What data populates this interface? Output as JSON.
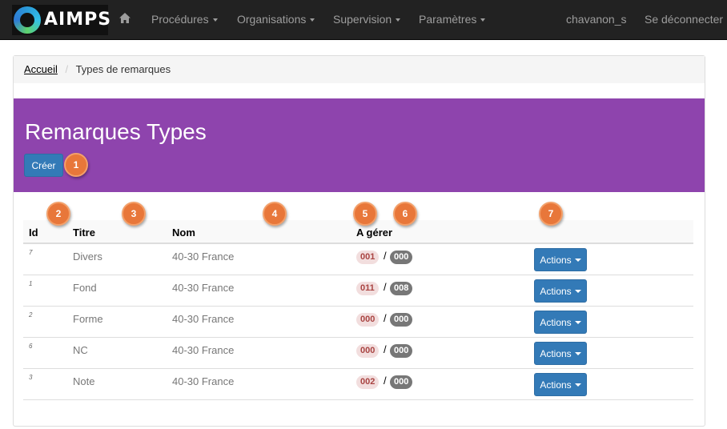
{
  "navbar": {
    "logo_text": "AIMPS",
    "items": [
      {
        "label": "Procédures"
      },
      {
        "label": "Organisations"
      },
      {
        "label": "Supervision"
      },
      {
        "label": "Paramètres"
      }
    ],
    "user": "chavanon_s",
    "logout": "Se déconnecter"
  },
  "breadcrumb": {
    "home": "Accueil",
    "current": "Types de remarques"
  },
  "page": {
    "title": "Remarques Types",
    "create_label": "Créer"
  },
  "table": {
    "headers": [
      "Id",
      "Titre",
      "Nom",
      "A gérer",
      ""
    ],
    "rows": [
      {
        "id": "7",
        "titre": "Divers",
        "nom": "40-30 France",
        "manage": "001",
        "total": "000",
        "action": "Actions"
      },
      {
        "id": "1",
        "titre": "Fond",
        "nom": "40-30 France",
        "manage": "011",
        "total": "008",
        "action": "Actions"
      },
      {
        "id": "2",
        "titre": "Forme",
        "nom": "40-30 France",
        "manage": "000",
        "total": "000",
        "action": "Actions"
      },
      {
        "id": "6",
        "titre": "NC",
        "nom": "40-30 France",
        "manage": "000",
        "total": "000",
        "action": "Actions"
      },
      {
        "id": "3",
        "titre": "Note",
        "nom": "40-30 France",
        "manage": "002",
        "total": "000",
        "action": "Actions"
      }
    ],
    "separator": "/"
  },
  "markers": [
    "1",
    "2",
    "3",
    "4",
    "5",
    "6",
    "7"
  ],
  "colors": {
    "navbar": "#222222",
    "jumbotron": "#8e44ad",
    "primary": "#337ab7",
    "marker": "#e8773a"
  }
}
